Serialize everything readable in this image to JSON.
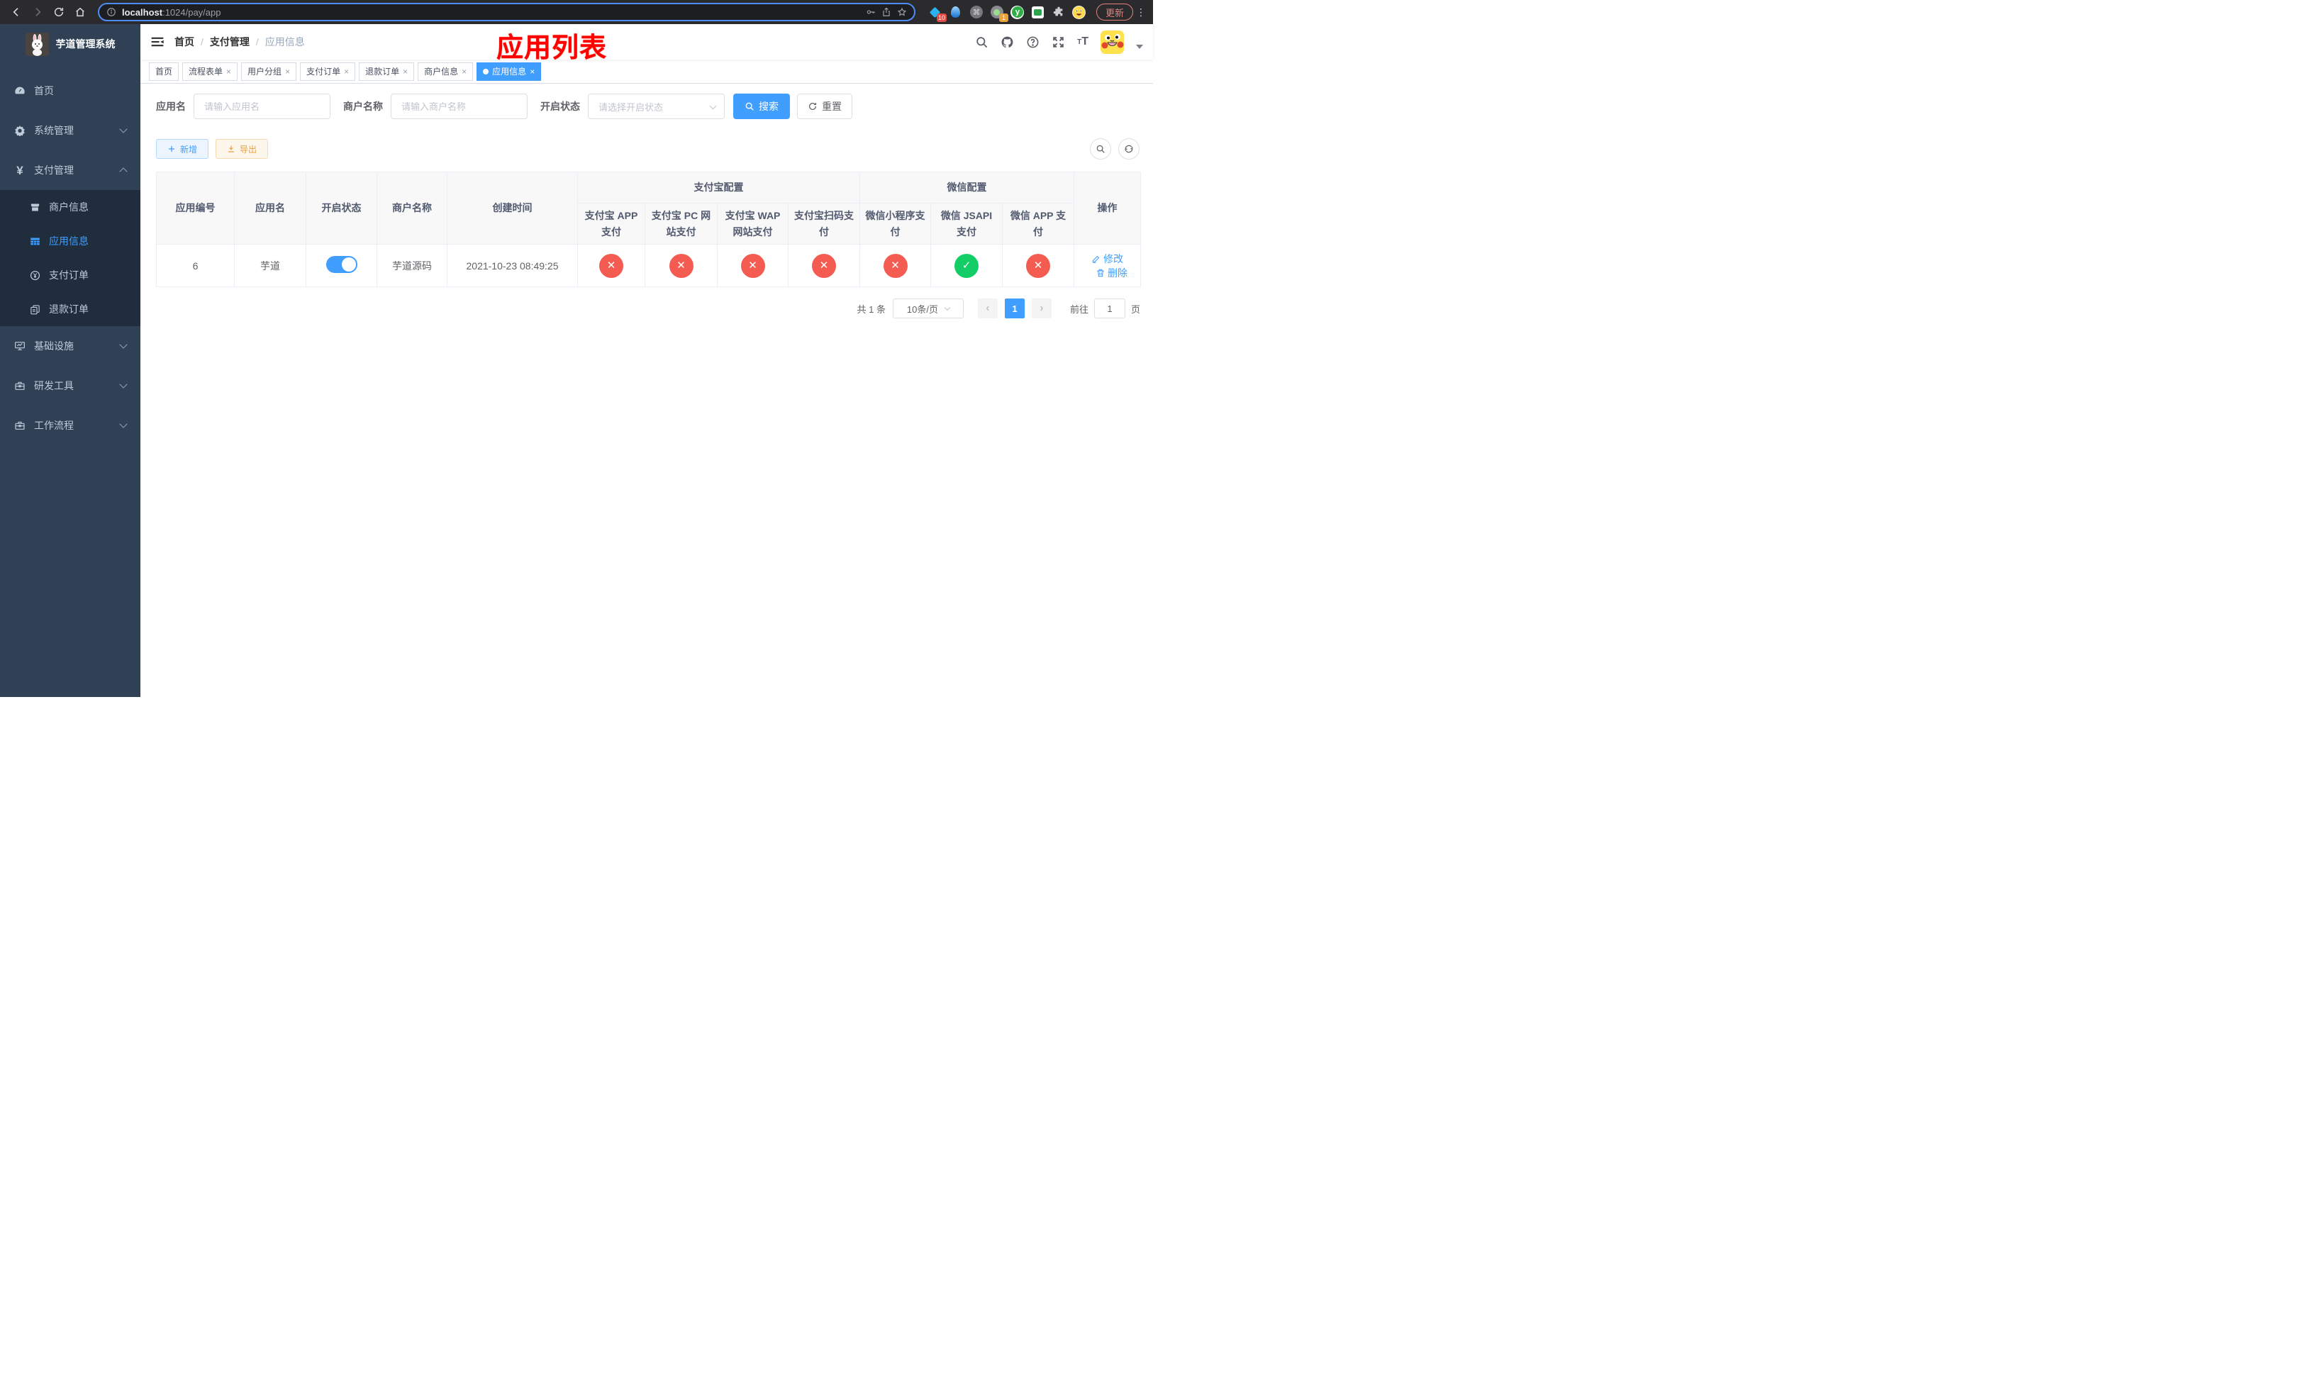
{
  "browser": {
    "url_host": "localhost",
    "url_rest": ":1024/pay/app",
    "ext_badge_1": "10",
    "ext_badge_2": "1",
    "update_label": "更新"
  },
  "sidebar": {
    "title": "芋道管理系统",
    "items": [
      "首页",
      "系统管理",
      "支付管理",
      "商户信息",
      "应用信息",
      "支付订单",
      "退款订单",
      "基础设施",
      "研发工具",
      "工作流程"
    ]
  },
  "navbar": {
    "breadcrumb": [
      "首页",
      "支付管理",
      "应用信息"
    ],
    "separator": "/"
  },
  "annotation": "应用列表",
  "tabs": [
    "首页",
    "流程表单",
    "用户分组",
    "支付订单",
    "退款订单",
    "商户信息",
    "应用信息"
  ],
  "filters": {
    "app_name_label": "应用名",
    "app_name_placeholder": "请输入应用名",
    "merchant_label": "商户名称",
    "merchant_placeholder": "请输入商户名称",
    "status_label": "开启状态",
    "status_placeholder": "请选择开启状态",
    "search_label": "搜索",
    "reset_label": "重置"
  },
  "toolbar": {
    "add_label": "新增",
    "export_label": "导出"
  },
  "table": {
    "headers": {
      "id": "应用编号",
      "name": "应用名",
      "status": "开启状态",
      "merchant": "商户名称",
      "created": "创建时间",
      "alipay_group": "支付宝配置",
      "wechat_group": "微信配置",
      "actions": "操作"
    },
    "channel_headers": [
      "支付宝 APP 支付",
      "支付宝 PC 网站支付",
      "支付宝 WAP 网站支付",
      "支付宝扫码支付",
      "微信小程序支付",
      "微信 JSAPI 支付",
      "微信 APP 支付"
    ],
    "row": {
      "id": "6",
      "name": "芋道",
      "status_on": true,
      "merchant": "芋道源码",
      "created": "2021-10-23 08:49:25",
      "channels": [
        {
          "name": "alipay-app",
          "enabled": false
        },
        {
          "name": "alipay-pc",
          "enabled": false
        },
        {
          "name": "alipay-wap",
          "enabled": false
        },
        {
          "name": "alipay-qr",
          "enabled": false
        },
        {
          "name": "wx-lite",
          "enabled": false
        },
        {
          "name": "wx-jsapi",
          "enabled": true
        },
        {
          "name": "wx-app",
          "enabled": false
        }
      ],
      "edit_label": "修改",
      "delete_label": "删除"
    }
  },
  "pagination": {
    "total": "共 1 条",
    "page_size": "10条/页",
    "page": "1",
    "goto_label": "前往",
    "goto_value": "1",
    "page_suffix": "页"
  },
  "colors": {
    "accent": "#409eff",
    "danger": "#f45c52",
    "success": "#13ce66",
    "warning": "#e6a23c",
    "sidebar_bg": "#304156",
    "submenu_bg": "#1f2d3d"
  }
}
